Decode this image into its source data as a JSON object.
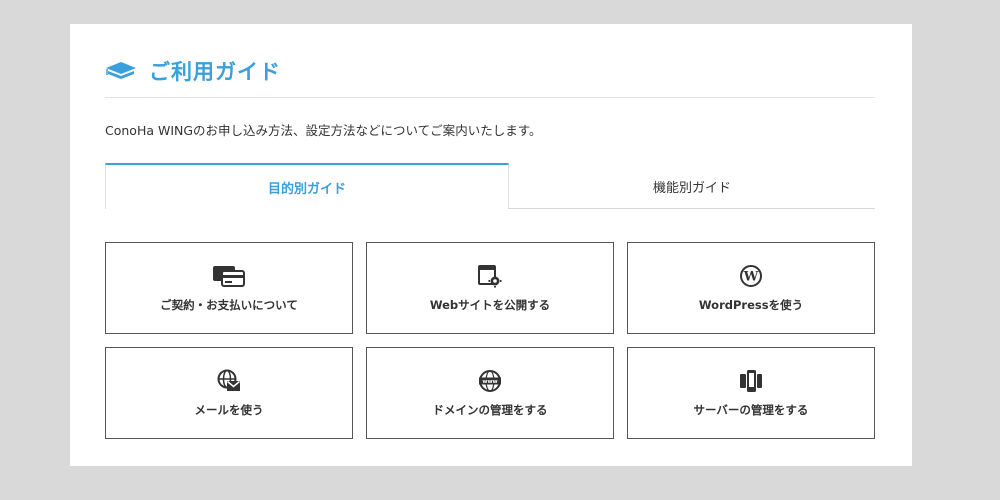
{
  "guide": {
    "title": "ご利用ガイド",
    "title_icon": "book-icon",
    "intro": "ConoHa WINGのお申し込み方法、設定方法などについてご案内いたします。",
    "accent_color": "#3aa0dc",
    "tabs": [
      {
        "label": "目的別ガイド",
        "active": true
      },
      {
        "label": "機能別ガイド",
        "active": false
      }
    ],
    "cards": [
      {
        "label": "ご契約・お支払いについて",
        "icon": "credit-card-icon"
      },
      {
        "label": "Webサイトを公開する",
        "icon": "website-settings-icon"
      },
      {
        "label": "WordPressを使う",
        "icon": "wordpress-icon"
      },
      {
        "label": "メールを使う",
        "icon": "mail-globe-icon"
      },
      {
        "label": "ドメインの管理をする",
        "icon": "www-globe-icon"
      },
      {
        "label": "サーバーの管理をする",
        "icon": "devices-icon"
      }
    ]
  }
}
